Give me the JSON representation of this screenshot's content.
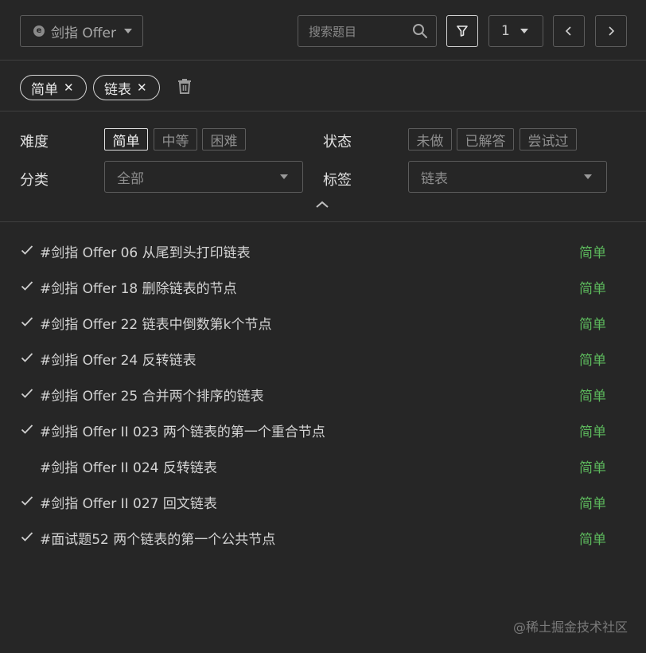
{
  "toolbar": {
    "source_label": "剑指 Offer",
    "source_logo": "e",
    "search_placeholder": "搜索题目",
    "page": "1"
  },
  "active_tags": [
    {
      "label": "简单"
    },
    {
      "label": "链表"
    }
  ],
  "filters": {
    "difficulty_label": "难度",
    "difficulty_options": [
      "简单",
      "中等",
      "困难"
    ],
    "difficulty_selected": "简单",
    "status_label": "状态",
    "status_options": [
      "未做",
      "已解答",
      "尝试过"
    ],
    "category_label": "分类",
    "category_value": "全部",
    "tag_label": "标签",
    "tag_value": "链表"
  },
  "problems": [
    {
      "title": "#剑指 Offer 06 从尾到头打印链表",
      "difficulty": "简单",
      "solved": true
    },
    {
      "title": "#剑指 Offer 18 删除链表的节点",
      "difficulty": "简单",
      "solved": true
    },
    {
      "title": "#剑指 Offer 22 链表中倒数第k个节点",
      "difficulty": "简单",
      "solved": true
    },
    {
      "title": "#剑指 Offer 24 反转链表",
      "difficulty": "简单",
      "solved": true
    },
    {
      "title": "#剑指 Offer 25 合并两个排序的链表",
      "difficulty": "简单",
      "solved": true
    },
    {
      "title": "#剑指 Offer II 023 两个链表的第一个重合节点",
      "difficulty": "简单",
      "solved": true
    },
    {
      "title": "#剑指 Offer II 024 反转链表",
      "difficulty": "简单",
      "solved": false
    },
    {
      "title": "#剑指 Offer II 027 回文链表",
      "difficulty": "简单",
      "solved": true
    },
    {
      "title": "#面试题52 两个链表的第一个公共节点",
      "difficulty": "简单",
      "solved": true
    }
  ],
  "watermark": "@稀土掘金技术社区",
  "colors": {
    "background": "#262626",
    "easy": "#5cb85c",
    "border": "#5c5c5c"
  }
}
